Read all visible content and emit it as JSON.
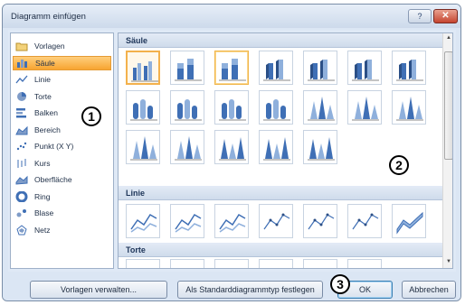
{
  "window": {
    "title": "Diagramm einfügen",
    "help_label": "?",
    "close_label": "✕"
  },
  "chart_types": [
    {
      "label": "Vorlagen",
      "icon": "folder-icon",
      "selected": false
    },
    {
      "label": "Säule",
      "icon": "column-chart-icon",
      "selected": true
    },
    {
      "label": "Linie",
      "icon": "line-chart-icon",
      "selected": false
    },
    {
      "label": "Torte",
      "icon": "pie-chart-icon",
      "selected": false
    },
    {
      "label": "Balken",
      "icon": "bar-chart-icon",
      "selected": false
    },
    {
      "label": "Bereich",
      "icon": "area-chart-icon",
      "selected": false
    },
    {
      "label": "Punkt (X Y)",
      "icon": "scatter-chart-icon",
      "selected": false
    },
    {
      "label": "Kurs",
      "icon": "stock-chart-icon",
      "selected": false
    },
    {
      "label": "Oberfläche",
      "icon": "surface-chart-icon",
      "selected": false
    },
    {
      "label": "Ring",
      "icon": "doughnut-chart-icon",
      "selected": false
    },
    {
      "label": "Blase",
      "icon": "bubble-chart-icon",
      "selected": false
    },
    {
      "label": "Netz",
      "icon": "radar-chart-icon",
      "selected": false
    }
  ],
  "sections": {
    "column": {
      "label": "Säule"
    },
    "line": {
      "label": "Linie"
    },
    "pie": {
      "label": "Torte"
    }
  },
  "buttons": {
    "manage_templates": "Vorlagen verwalten...",
    "set_default": "Als Standarddiagrammtyp festlegen",
    "ok": "OK",
    "cancel": "Abbrechen"
  },
  "annotations": [
    "1",
    "2",
    "3"
  ],
  "colors": {
    "selection": "#f7a431",
    "accent": "#3f6fb5",
    "window": "#dbe6f4"
  }
}
